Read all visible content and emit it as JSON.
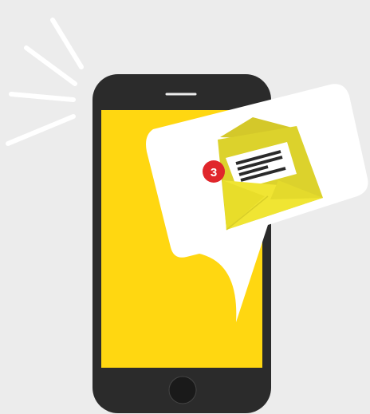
{
  "scene": {
    "background_color": "#ececec",
    "phone": {
      "body_color": "#2b2b2b",
      "screen_color": "#ffd711",
      "icons": [
        "speaker-icon",
        "home-button-icon"
      ]
    },
    "notification": {
      "bubble_color": "#ffffff",
      "envelope_color": "#e8e044",
      "letter_color": "#ffffff",
      "badge": {
        "count": "3",
        "color": "#e0262b"
      }
    },
    "vibration_lines_color": "#ffffff"
  }
}
